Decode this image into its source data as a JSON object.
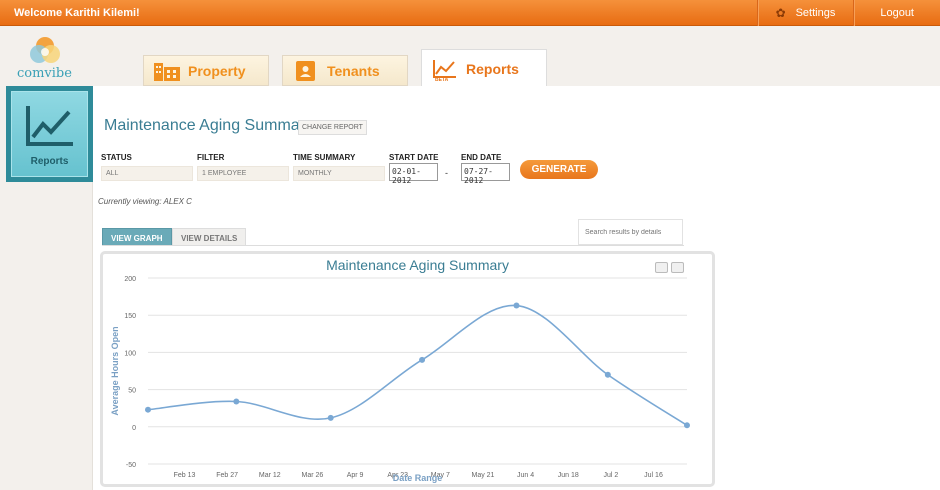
{
  "header": {
    "welcome": "Welcome Karithi Kilemi!",
    "settings": "Settings",
    "logout": "Logout"
  },
  "brand": {
    "logo_text": "comvibe"
  },
  "tabs": [
    {
      "label": "Property",
      "icon": "building-icon"
    },
    {
      "label": "Tenants",
      "icon": "contact-book-icon"
    },
    {
      "label": "Reports",
      "icon": "line-chart-icon",
      "badge": "BETA"
    }
  ],
  "sidebar": {
    "label": "Reports",
    "icon": "line-chart-icon"
  },
  "report": {
    "title": "Maintenance Aging Summary",
    "change_label": "CHANGE REPORT"
  },
  "filters": {
    "status_label": "STATUS",
    "status_value": "ALL",
    "filter_label": "FILTER",
    "filter_value": "1 EMPLOYEE",
    "time_label": "TIME SUMMARY",
    "time_value": "MONTHLY",
    "start_label": "START DATE",
    "start_value": "02-01-2012",
    "end_label": "END DATE",
    "end_value": "07-27-2012",
    "dash": "-",
    "generate_label": "GENERATE"
  },
  "viewing": "Currently viewing: ALEX C",
  "view_tabs": {
    "graph": "VIEW GRAPH",
    "details": "VIEW DETAILS"
  },
  "search": {
    "placeholder": "Search results by details"
  },
  "colors": {
    "accent": "#e8761c",
    "teal": "#2e8b99",
    "series": "#7aa8d4"
  },
  "chart_data": {
    "type": "line",
    "title": "Maintenance Aging Summary",
    "xlabel": "Date Range",
    "ylabel": "Average Hours Open",
    "ylim": [
      -50,
      200
    ],
    "yticks": [
      200,
      150,
      100,
      50,
      0,
      -50
    ],
    "xticks": [
      "Feb 13",
      "Feb 27",
      "Mar 12",
      "Mar 26",
      "Apr 9",
      "Apr 23",
      "May 7",
      "May 21",
      "Jun 4",
      "Jun 18",
      "Jul 2",
      "Jul 16"
    ],
    "grid": true,
    "series": [
      {
        "points": [
          {
            "x": "2012-02-01",
            "y": 23
          },
          {
            "x": "2012-03-01",
            "y": 34
          },
          {
            "x": "2012-04-01",
            "y": 12
          },
          {
            "x": "2012-05-01",
            "y": 90
          },
          {
            "x": "2012-06-01",
            "y": 163
          },
          {
            "x": "2012-07-01",
            "y": 70
          },
          {
            "x": "2012-07-27",
            "y": 2
          }
        ]
      }
    ]
  }
}
